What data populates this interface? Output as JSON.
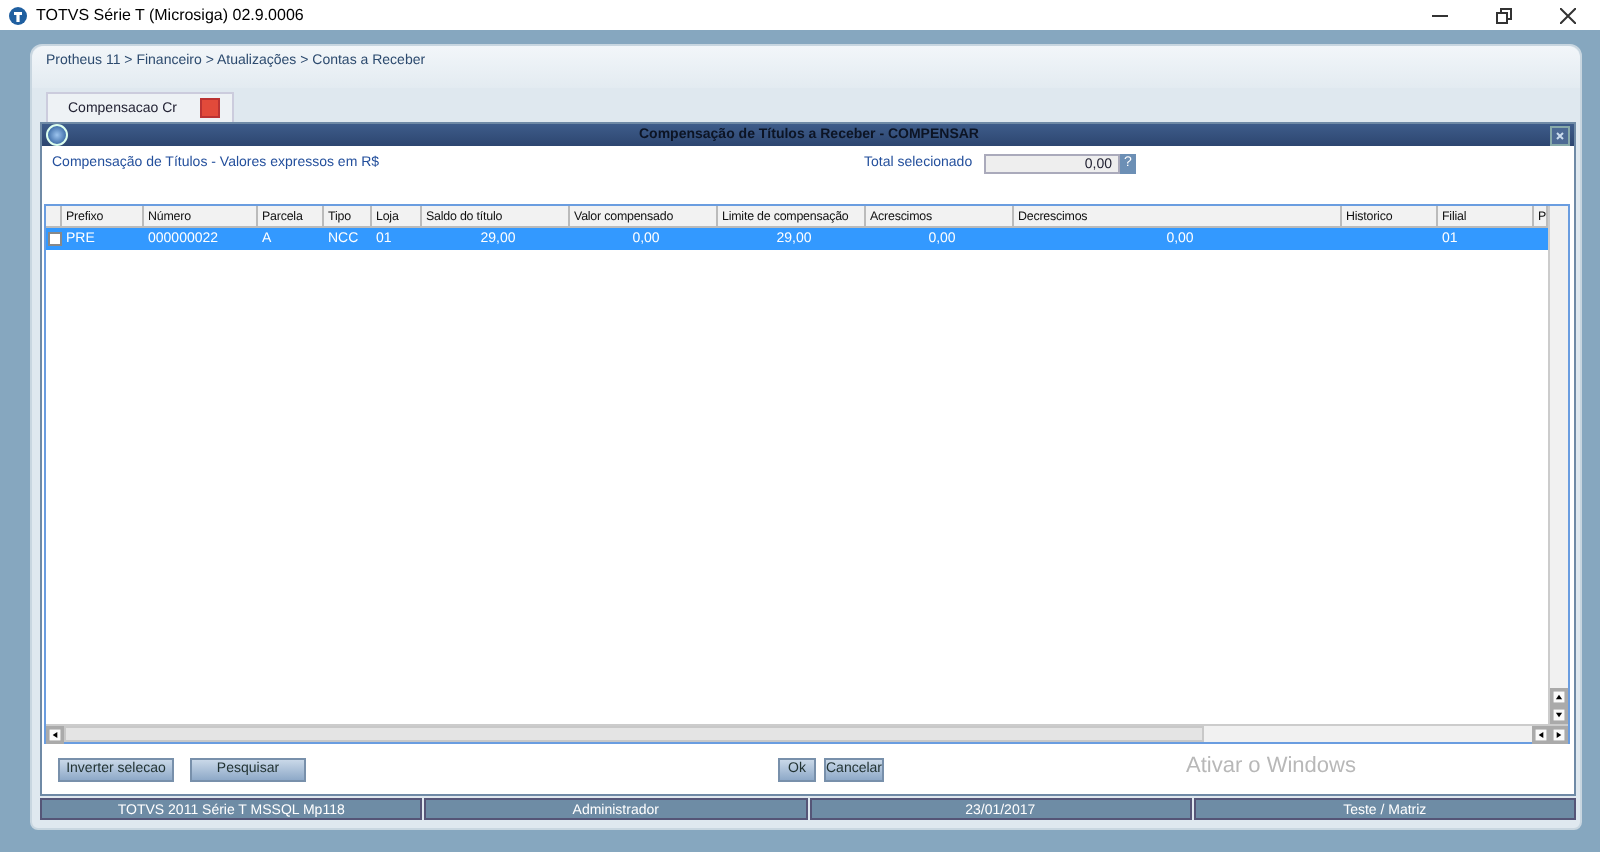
{
  "window": {
    "title": "TOTVS Série T  (Microsiga) 02.9.0006"
  },
  "breadcrumb": "Protheus 11 > Financeiro > Atualizações > Contas a Receber",
  "tabs": [
    {
      "label": "Compensacao Cr",
      "selected": true
    }
  ],
  "dialog": {
    "title": "Compensação de Títulos a Receber - COMPENSAR",
    "subtitle": "Compensação de Títulos - Valores expressos em R$",
    "total_label": "Total selecionado",
    "total_value": "0,00",
    "help": "?"
  },
  "table": {
    "columns": [
      "Prefixo",
      "Número",
      "Parcela",
      "Tipo",
      "Loja",
      "Saldo do título",
      "Valor compensado",
      "Limite de compensação",
      "Acrescimos",
      "Decrescimos",
      "Historico",
      "Filial",
      "P"
    ],
    "rows": [
      {
        "selected": true,
        "checked": false,
        "cells": [
          "PRE",
          "000000022",
          "A",
          "NCC",
          "01",
          "29,00",
          "0,00",
          "29,00",
          "0,00",
          "0,00",
          "",
          "01",
          ""
        ]
      }
    ]
  },
  "buttons": [
    "Inverter selecao",
    "Pesquisar",
    "Ok",
    "Cancelar"
  ],
  "watermark_text": "Ativar o Windows",
  "status_bar": [
    "TOTVS 2011 Série T  MSSQL Mp118",
    "Administrador",
    "23/01/2017",
    "Teste / Matriz"
  ]
}
